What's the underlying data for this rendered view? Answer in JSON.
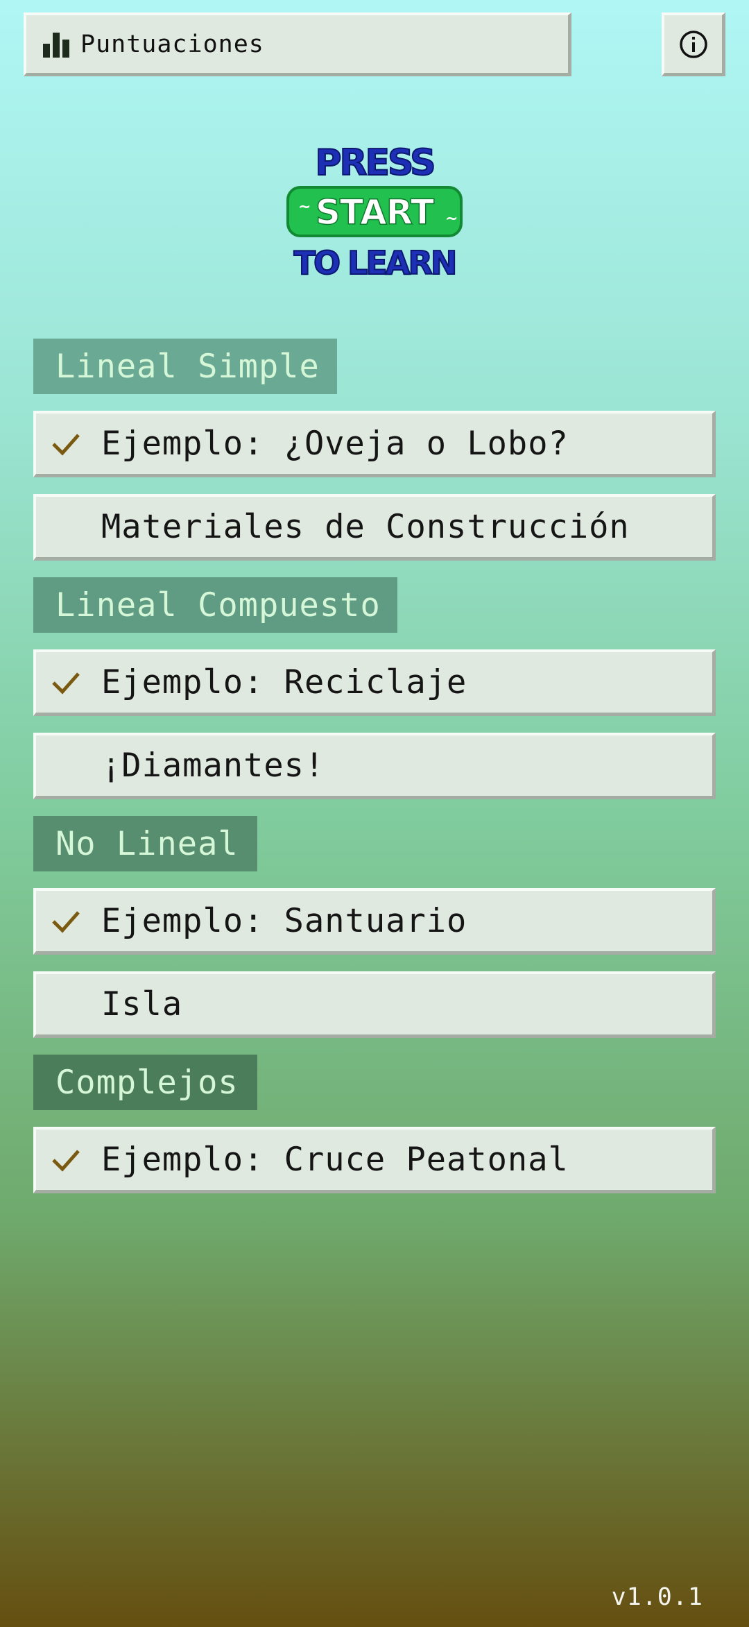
{
  "header": {
    "scores_label": "Puntuaciones",
    "scores_icon": "bar-chart-icon",
    "info_icon": "info-icon"
  },
  "logo": {
    "line1": "PRESS",
    "line2": "START",
    "line3": "TO LEARN",
    "colors": {
      "text": "#1c2fb5",
      "pill": "#22c04f",
      "pill_text": "#ffffff"
    }
  },
  "sections": [
    {
      "title": "Lineal Simple",
      "color": "#6aaa94",
      "items": [
        {
          "label": "Ejemplo: ¿Oveja o Lobo?",
          "completed": true
        },
        {
          "label": "Materiales de Construcción",
          "completed": false
        }
      ]
    },
    {
      "title": "Lineal Compuesto",
      "color": "#5f9c83",
      "items": [
        {
          "label": "Ejemplo: Reciclaje",
          "completed": true
        },
        {
          "label": "¡Diamantes!",
          "completed": false
        }
      ]
    },
    {
      "title": "No Lineal",
      "color": "#568e6f",
      "items": [
        {
          "label": "Ejemplo: Santuario",
          "completed": true
        },
        {
          "label": "Isla",
          "completed": false
        }
      ]
    },
    {
      "title": "Complejos",
      "color": "#4c7d5a",
      "items": [
        {
          "label": "Ejemplo: Cruce Peatonal",
          "completed": true
        }
      ]
    }
  ],
  "check_icon": "checkmark-icon",
  "check_color": "#7a5a10",
  "version": "v1.0.1"
}
